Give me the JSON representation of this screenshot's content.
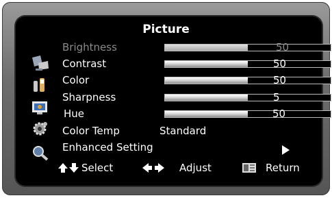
{
  "menu": {
    "title": "Picture",
    "items": [
      {
        "label": "Brightness",
        "value": "50",
        "level": 0.5
      },
      {
        "label": "Contrast",
        "value": "50",
        "level": 0.5
      },
      {
        "label": "Color",
        "value": "50",
        "level": 0.5
      },
      {
        "label": "Sharpness",
        "value": "5",
        "level": 0.5
      },
      {
        "label": "Hue",
        "value": "50",
        "level": 0.5
      }
    ],
    "color_temp": {
      "label": "Color Temp",
      "value": "Standard"
    },
    "enhanced": {
      "label": "Enhanced Setting"
    }
  },
  "footer": {
    "select": "Select",
    "adjust": "Adjust",
    "return": "Return"
  },
  "icons": [
    "picture-icon",
    "sound-icon",
    "tv-icon",
    "gear-icon",
    "magnifier-icon"
  ],
  "colors": {
    "background": "#000000",
    "text": "#ffffff",
    "dim_text": "#8a8a8a",
    "frame": "#6e6e6e"
  }
}
